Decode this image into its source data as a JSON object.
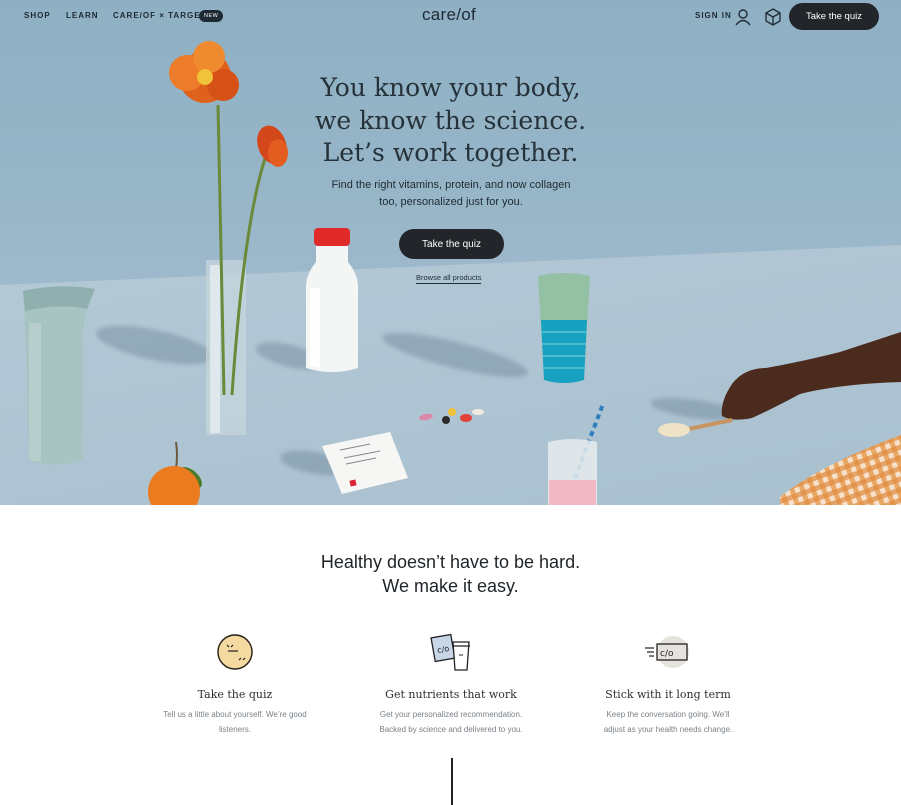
{
  "nav": {
    "links": [
      "SHOP",
      "LEARN",
      "CARE/OF × TARGET"
    ],
    "badge": "NEW",
    "logo": "care/of",
    "sign_in": "SIGN IN",
    "cta": "Take the quiz"
  },
  "hero": {
    "headline": [
      "You know your body,",
      "we know the science.",
      "Let’s work together."
    ],
    "subhead": [
      "Find the right vitamins, protein, and now collagen",
      "too, personalized just for you."
    ],
    "cta": "Take the quiz",
    "browse": "Browse all products"
  },
  "how": {
    "title": [
      "Healthy doesn’t have to be hard.",
      "We make it easy."
    ],
    "steps": [
      {
        "title": "Take the quiz",
        "text": [
          "Tell us a little about yourself. We’re good",
          "listeners."
        ]
      },
      {
        "title": "Get nutrients that work",
        "text": [
          "Get your personalized recommendation.",
          "Backed by science and delivered to you."
        ]
      },
      {
        "title": "Stick with it long term",
        "text": [
          "Keep the conversation going. We’ll",
          "adjust as your health needs change."
        ]
      }
    ]
  },
  "colors": {
    "dark": "#22262a",
    "hero_bg": "#97b6c8",
    "accent_yellow": "#f4d9a0"
  }
}
